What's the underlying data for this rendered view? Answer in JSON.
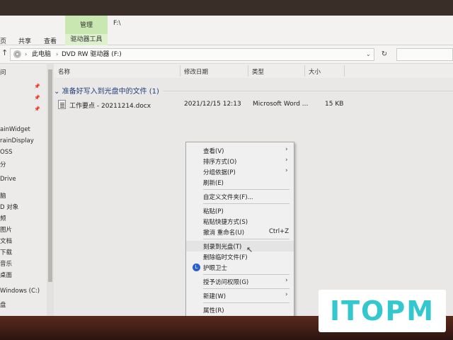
{
  "ribbon": {
    "tabs": [
      "页",
      "共享",
      "查看"
    ],
    "manage_label": "管理",
    "drive_tools_label": "驱动器工具",
    "path_title": "F:\\"
  },
  "address": {
    "segments": [
      "此电脑",
      "DVD RW 驱动器 (F:)"
    ],
    "search_placeholder": ""
  },
  "nav": {
    "items": [
      {
        "label": "问",
        "pinned": false
      },
      {
        "label": "",
        "pinned": true
      },
      {
        "label": "",
        "pinned": true
      },
      {
        "label": "",
        "pinned": true
      },
      {
        "label": "ainWidget",
        "pinned": false
      },
      {
        "label": "rainDisplay",
        "pinned": false
      },
      {
        "label": "OSS",
        "pinned": false
      },
      {
        "label": "分",
        "pinned": false
      },
      {
        "label": "Drive",
        "pinned": false
      },
      {
        "label": "脑",
        "pinned": false
      },
      {
        "label": "D 对象",
        "pinned": false
      },
      {
        "label": "频",
        "pinned": false
      },
      {
        "label": "图片",
        "pinned": false
      },
      {
        "label": "文档",
        "pinned": false
      },
      {
        "label": "下载",
        "pinned": false
      },
      {
        "label": "音乐",
        "pinned": false
      },
      {
        "label": "桌面",
        "pinned": false
      },
      {
        "label": "Windows (C:)",
        "pinned": false
      },
      {
        "label": "盘",
        "pinned": false
      }
    ]
  },
  "columns": [
    "名称",
    "修改日期",
    "类型",
    "大小"
  ],
  "group": {
    "title": "准备好写入到光盘中的文件 (1)"
  },
  "files": [
    {
      "name": "工作要点 - 20211214.docx",
      "modified": "2021/12/15 12:13",
      "type": "Microsoft Word ...",
      "size": "15 KB"
    }
  ],
  "context_menu": {
    "items": [
      {
        "label": "查看(V)",
        "arrow": true
      },
      {
        "label": "排序方式(O)",
        "arrow": true
      },
      {
        "label": "分组依据(P)",
        "arrow": true
      },
      {
        "label": "刷新(E)"
      },
      {
        "label": "自定义文件夹(F)..."
      },
      {
        "label": "粘贴(P)"
      },
      {
        "label": "粘贴快捷方式(S)"
      },
      {
        "label": "撤消 重命名(U)",
        "shortcut": "Ctrl+Z"
      },
      {
        "label": "刻录到光盘(T)"
      },
      {
        "label": "删除临时文件(F)"
      },
      {
        "label": "护眼卫士",
        "icon": "guard-icon"
      },
      {
        "label": "授予访问权限(G)",
        "arrow": true
      },
      {
        "label": "新建(W)",
        "arrow": true
      },
      {
        "label": "属性(R)"
      }
    ]
  },
  "logo": {
    "text": "ITOPM",
    "color": "#33c7cf"
  },
  "colors": {
    "manage_tab": "#c9e7b0",
    "group_title": "#1f3f7a"
  }
}
